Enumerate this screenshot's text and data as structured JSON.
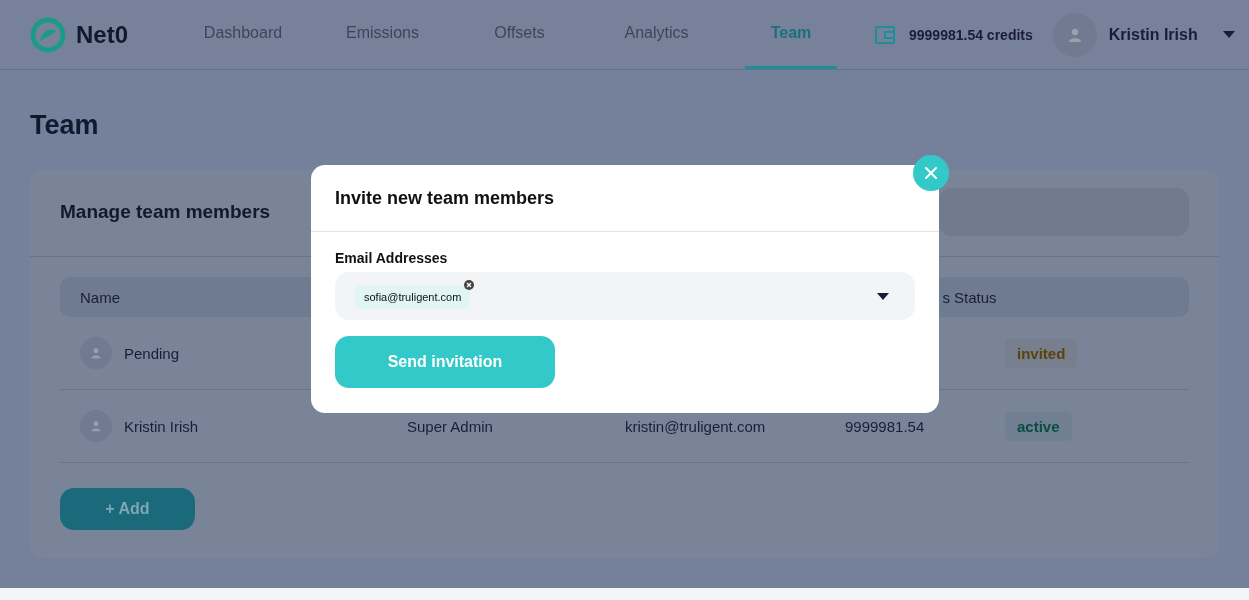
{
  "brand": {
    "name": "Net0"
  },
  "nav": {
    "tabs": [
      {
        "label": "Dashboard",
        "selected": false
      },
      {
        "label": "Emissions",
        "selected": false
      },
      {
        "label": "Offsets",
        "selected": false
      },
      {
        "label": "Analytics",
        "selected": false
      },
      {
        "label": "Team",
        "selected": true
      }
    ],
    "credits": "9999981.54 credits",
    "user": "Kristin Irish"
  },
  "page_title": "Team",
  "card": {
    "title": "Manage team members",
    "table": {
      "columns": {
        "name": "Name",
        "credits_tail": "s",
        "status": "Status"
      },
      "rows": [
        {
          "name": "Pending",
          "status": {
            "label": "invited",
            "color": "#5a420a"
          }
        },
        {
          "name": "Kristin Irish",
          "role": "Super Admin",
          "email": "kristin@truligent.com",
          "credits": "9999981.54",
          "status": {
            "label": "active",
            "color": "#0a4d43"
          }
        }
      ]
    },
    "add_button": "+ Add"
  },
  "modal": {
    "title": "Invite new team members",
    "field_label": "Email Addresses",
    "emails": [
      "sofia@truligent.com"
    ],
    "submit": "Send invitation"
  }
}
